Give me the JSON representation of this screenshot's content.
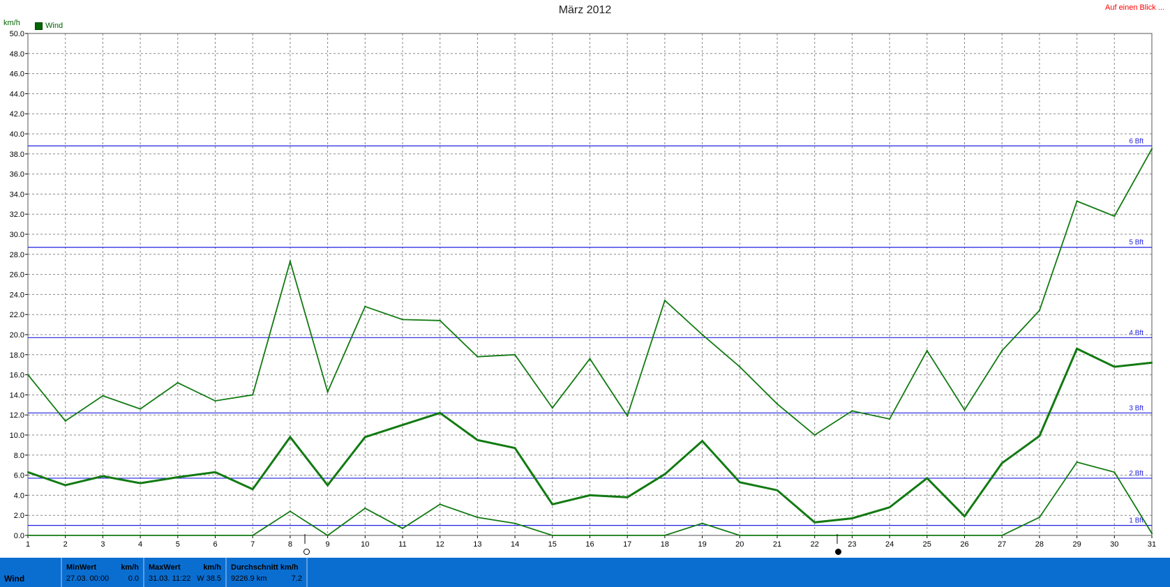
{
  "title": "März 2012",
  "overview_link": "Auf einen Blick ...",
  "unit": "km/h",
  "colors": {
    "series": "#127a12",
    "beaufort": "#2020e0",
    "grid": "#888888",
    "stats_bar": "#0a6ed1"
  },
  "chart_data": {
    "type": "line",
    "title": "März 2012",
    "ylabel": "km/h",
    "ylim": [
      0,
      50
    ],
    "yticks": [
      "0.0",
      "2.0",
      "4.0",
      "6.0",
      "8.0",
      "10.0",
      "12.0",
      "14.0",
      "16.0",
      "18.0",
      "20.0",
      "22.0",
      "24.0",
      "26.0",
      "28.0",
      "30.0",
      "32.0",
      "34.0",
      "36.0",
      "38.0",
      "40.0",
      "42.0",
      "44.0",
      "46.0",
      "48.0",
      "50.0"
    ],
    "x": [
      1,
      2,
      3,
      4,
      5,
      6,
      7,
      8,
      9,
      10,
      11,
      12,
      13,
      14,
      15,
      16,
      17,
      18,
      19,
      20,
      21,
      22,
      23,
      24,
      25,
      26,
      27,
      28,
      29,
      30,
      31
    ],
    "grid": true,
    "legend_position": "top-left",
    "legend": [
      "Wind"
    ],
    "series": [
      {
        "role": "max",
        "values": [
          16.0,
          11.4,
          13.9,
          12.6,
          15.2,
          13.4,
          14.0,
          27.3,
          14.3,
          22.8,
          21.5,
          21.4,
          17.8,
          18.0,
          12.7,
          17.6,
          11.9,
          23.4,
          20.0,
          16.8,
          13.1,
          10.0,
          12.4,
          11.6,
          18.4,
          12.5,
          18.4,
          22.4,
          33.3,
          31.8,
          38.5
        ]
      },
      {
        "role": "avg",
        "values": [
          6.3,
          5.0,
          5.9,
          5.2,
          5.8,
          6.3,
          4.6,
          9.8,
          5.0,
          9.8,
          11.0,
          12.2,
          9.5,
          8.7,
          3.1,
          4.0,
          3.8,
          6.1,
          9.4,
          5.3,
          4.5,
          1.3,
          1.7,
          2.8,
          5.7,
          1.9,
          7.2,
          9.9,
          18.6,
          16.8,
          17.2
        ]
      },
      {
        "role": "min",
        "values": [
          0.0,
          0.0,
          0.0,
          0.0,
          0.0,
          0.0,
          0.0,
          2.4,
          0.0,
          2.7,
          0.7,
          3.1,
          1.8,
          1.2,
          0.0,
          0.0,
          0.0,
          0.0,
          1.2,
          0.0,
          0.0,
          0.0,
          0.0,
          0.0,
          0.0,
          0.0,
          0.0,
          1.8,
          7.3,
          6.3,
          0.2
        ]
      }
    ],
    "reference_lines": [
      {
        "label": "1 Bft",
        "value": 1.0
      },
      {
        "label": "2 Bft",
        "value": 5.7
      },
      {
        "label": "3 Bft",
        "value": 12.2
      },
      {
        "label": "4 Bft",
        "value": 19.7
      },
      {
        "label": "5 Bft",
        "value": 28.7
      },
      {
        "label": "6 Bft",
        "value": 38.8
      }
    ]
  },
  "stats": {
    "row_label": "Wind",
    "min": {
      "header": "MinWert",
      "unit": "km/h",
      "date": "27.03.  00:00",
      "value": "0.0"
    },
    "max": {
      "header": "MaxWert",
      "unit": "km/h",
      "date": "31.03.  11:22",
      "value": "W 38.5"
    },
    "avg": {
      "header": "Durchschnitt km/h",
      "unit": "",
      "date": "9226.9 km",
      "value": "7.2"
    }
  }
}
